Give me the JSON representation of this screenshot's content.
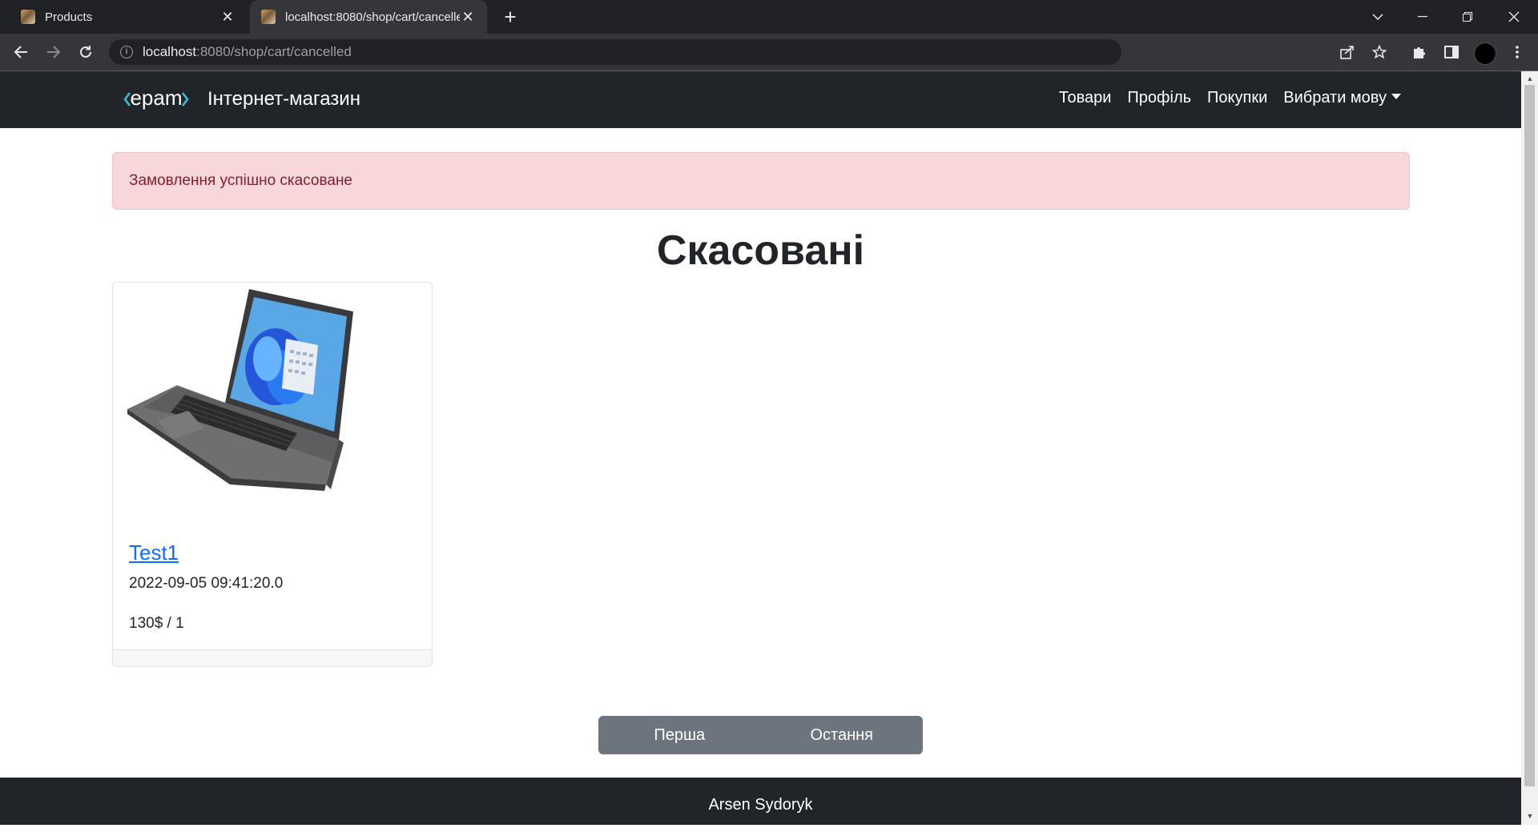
{
  "browser": {
    "tabs": [
      {
        "title": "Products",
        "active": false
      },
      {
        "title": "localhost:8080/shop/cart/cancelled",
        "active": true
      }
    ],
    "url_host": "localhost",
    "url_path": ":8080/shop/cart/cancelled",
    "icons": {
      "back": "arrow-left-icon",
      "forward": "arrow-right-icon",
      "reload": "reload-icon",
      "site_info": "info-icon",
      "share": "share-icon",
      "bookmark": "star-icon",
      "extensions": "puzzle-icon",
      "side_panel": "side-panel-icon",
      "menu": "kebab-menu-icon"
    }
  },
  "site": {
    "logo_text": "epam",
    "brand_name": "Інтернет-магазин",
    "menu": {
      "products": "Товари",
      "profile": "Профіль",
      "purchases": "Покупки",
      "language": "Вибрати мову"
    }
  },
  "alert": {
    "message": "Замовлення успішно скасоване",
    "color": "#f8d7da"
  },
  "page": {
    "title": "Скасовані"
  },
  "orders": [
    {
      "name": "Test1",
      "date": "2022-09-05 09:41:20.0",
      "price_qty": "130$ / 1"
    }
  ],
  "pagination": {
    "first": "Перша",
    "last": "Остання"
  },
  "footer": {
    "author": "Arsen Sydoryk"
  }
}
